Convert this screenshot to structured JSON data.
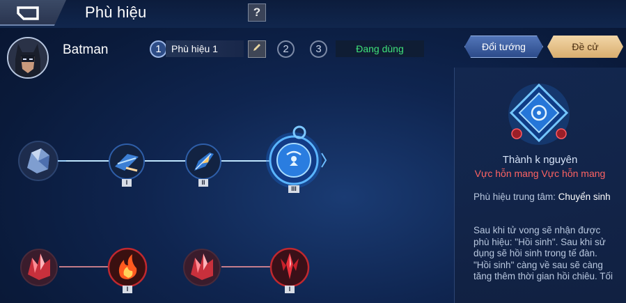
{
  "header": {
    "title": "Phù hiệu",
    "help_label": "?"
  },
  "hero": {
    "name": "Batman"
  },
  "pages": {
    "tabs": [
      {
        "number": "1"
      },
      {
        "number": "2"
      },
      {
        "number": "3"
      }
    ],
    "active_label": "Phù hiệu 1",
    "status": "Đang dùng"
  },
  "actions": {
    "change_hero": "Đổi tướng",
    "recommend": "Đề cử"
  },
  "tree": {
    "top_row": [
      {
        "icon": "crystal-shard-icon",
        "level": ""
      },
      {
        "icon": "blue-dagger-icon",
        "level": "I"
      },
      {
        "icon": "blue-blade-icon",
        "level": "II"
      },
      {
        "icon": "blue-core-emblem-icon",
        "level": "III"
      }
    ],
    "bottom_row": [
      {
        "icon": "red-crystal-icon",
        "level": ""
      },
      {
        "icon": "fire-icon",
        "level": "I"
      },
      {
        "icon": "red-crystal-icon",
        "level": ""
      },
      {
        "icon": "red-trident-icon",
        "level": "I"
      }
    ]
  },
  "detail": {
    "name": "Thành k nguyên",
    "requirement": "Vực hỗn mang  Vực hỗn mang",
    "core_prefix": "Phù hiệu trung tâm: ",
    "core_value": "Chuyển sinh",
    "description": "Sau khi tử vong sẽ nhận được phù hiệu: \"Hồi sinh\". Sau khi sử dụng sẽ hồi sinh trong tế đàn. \"Hồi sinh\" càng về sau sẽ càng tăng thêm thời gian hồi chiêu. Tối"
  },
  "colors": {
    "status_green": "#3fe37a",
    "requirement_red": "#ff6363",
    "blue_link": "#3aa6ff",
    "red_link": "#ff3a48"
  }
}
